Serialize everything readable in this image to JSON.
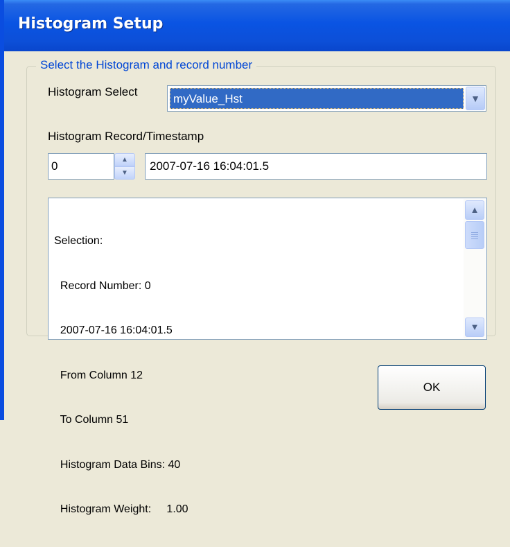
{
  "window": {
    "title": "Histogram Setup"
  },
  "group": {
    "legend": "Select the Histogram and record number"
  },
  "histogram_select": {
    "label": "Histogram Select",
    "value": "myValue_Hst"
  },
  "record": {
    "label": "Histogram Record/Timestamp",
    "number": "0",
    "timestamp": "2007-07-16 16:04:01.5"
  },
  "selection_text": {
    "lines": [
      "Selection:",
      "  Record Number: 0",
      "  2007-07-16 16:04:01.5",
      "  From Column 12",
      "  To Column 51",
      "  Histogram Data Bins: 40",
      "  Histogram Weight:     1.00"
    ]
  },
  "buttons": {
    "ok_label": "OK"
  },
  "colors": {
    "titlebar": "#0a54e3",
    "legend_text": "#0046d5",
    "selection_highlight": "#316ac5"
  }
}
